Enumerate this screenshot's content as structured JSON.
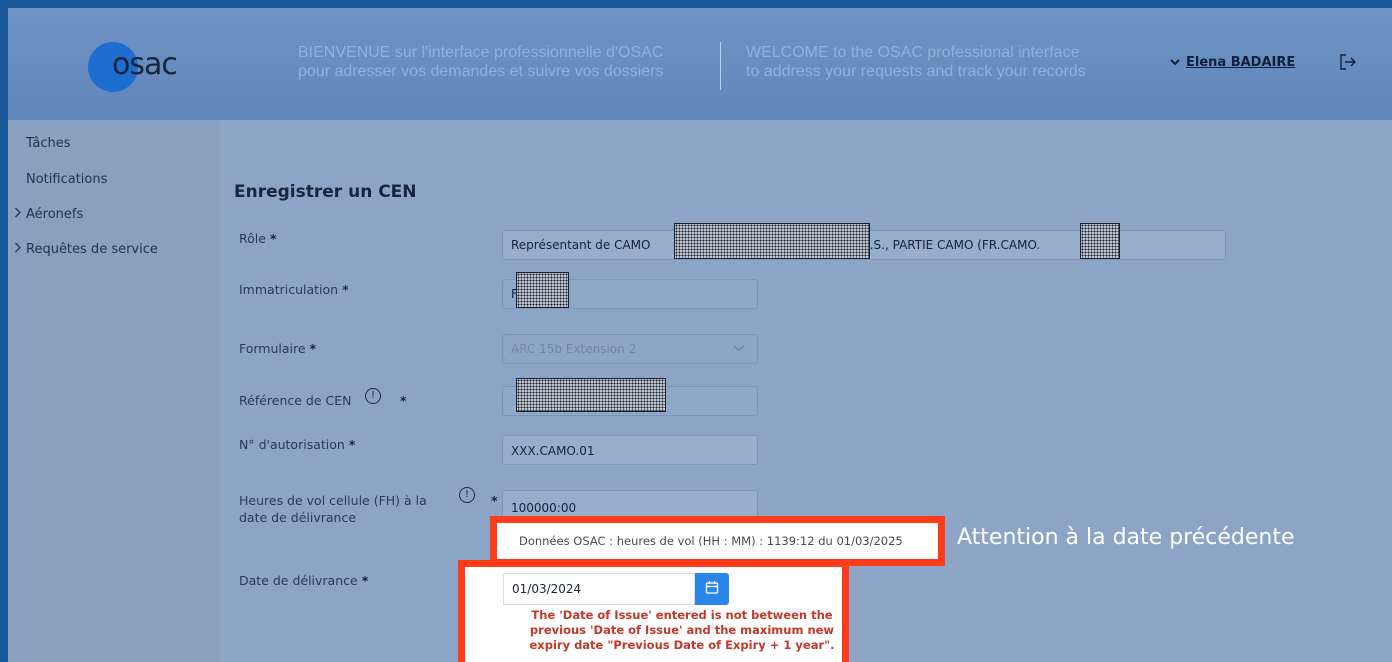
{
  "header": {
    "logo_text": "osac",
    "welcome_fr_line1": "BIENVENUE sur l'interface professionnelle d'OSAC",
    "welcome_fr_line2": "pour adresser vos demandes et suivre vos dossiers",
    "welcome_en_line1": "WELCOME to the OSAC professional interface",
    "welcome_en_line2": "to address your requests and track your records",
    "user_name": "Elena BADAIRE",
    "user_chevron_icon": "chevron-down-icon",
    "logout_icon": "logout-icon"
  },
  "sidebar": {
    "items": [
      {
        "label": "Tâches",
        "expandable": false
      },
      {
        "label": "Notifications",
        "expandable": false
      },
      {
        "label": "Aéronefs",
        "expandable": true
      },
      {
        "label": "Requêtes de service",
        "expandable": true
      }
    ]
  },
  "form": {
    "title": "Enregistrer un CEN",
    "required_marker": "*",
    "role": {
      "label": "Rôle",
      "value_prefix": "Représentant de CAMO",
      "value_middle": "S.A.S., PARTIE CAMO (FR.CAMO."
    },
    "immatriculation": {
      "label": "Immatriculation",
      "value_prefix": "F-"
    },
    "formulaire": {
      "label": "Formulaire",
      "value": "ARC 15b Extension 2"
    },
    "reference_cen": {
      "label": "Référence de CEN"
    },
    "autorisation": {
      "label": "N° d'autorisation",
      "value": "XXX.CAMO.01"
    },
    "heures_vol": {
      "label_line1": "Heures de vol cellule (FH) à la",
      "label_line2": "date de délivrance",
      "value": "100000:00"
    },
    "date_delivrance": {
      "label": "Date de délivrance",
      "value": "01/03/2024"
    }
  },
  "annotations": {
    "osac_data": "Données OSAC : heures de vol (HH : MM) : 1139:12 du 01/03/2025",
    "attention": "Attention à la date précédente",
    "error_message": "The 'Date of Issue' entered is not between the previous 'Date of Issue' and the maximum new expiry date \"Previous Date of Expiry + 1 year\".",
    "highlight_color": "#ff3b1a",
    "error_text_color": "#c0392b"
  },
  "colors": {
    "accent": "#2a86e8",
    "logo_blue": "#1e6dd0"
  }
}
